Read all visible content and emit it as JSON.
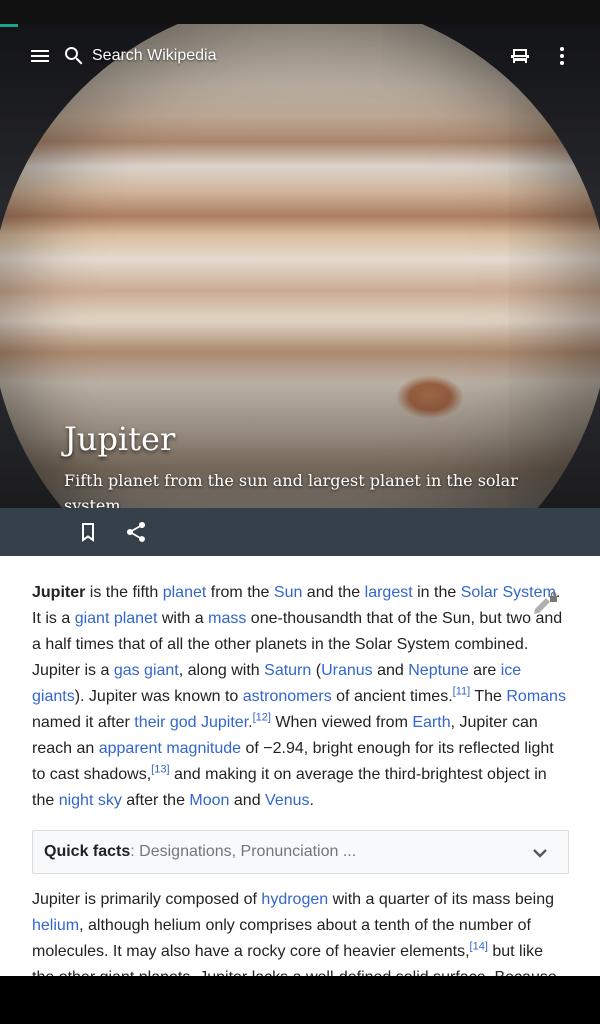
{
  "toolbar": {
    "search_placeholder": "Search Wikipedia",
    "menu_icon": "menu-icon",
    "search_icon": "search-icon",
    "reading_list_icon": "reading-lists-icon",
    "more_icon": "more-vert-icon"
  },
  "hero": {
    "title": "Jupiter",
    "subtitle": "Fifth planet from the sun and largest planet in the solar system"
  },
  "actions": {
    "save_icon": "bookmark-icon",
    "share_icon": "share-icon"
  },
  "lead": {
    "bold": "Jupiter",
    "t1": " is the fifth ",
    "l_planet": "planet",
    "t2": " from the ",
    "l_sun": "Sun",
    "t3": " and the ",
    "l_largest": "largest",
    "t4": " in the ",
    "l_solar_system": "Solar System",
    "t5": ". It is a ",
    "l_giant_planet": "giant planet",
    "t6": " with a ",
    "l_mass": "mass",
    "t7": " one-thousandth that of the Sun, but two and a half times that of all the other planets in the Solar System combined. Jupiter is a ",
    "l_gas_giant": "gas giant",
    "t8": ", along with ",
    "l_saturn": "Saturn",
    "t9": " (",
    "l_uranus": "Uranus",
    "t10": " and ",
    "l_neptune": "Neptune",
    "t11": " are ",
    "l_ice_giants": "ice giants",
    "t12": "). Jupiter was known to ",
    "l_astronomers": "astronomers",
    "t13": " of ancient times.",
    "ref11": "[11]",
    "t14": " The ",
    "l_romans": "Romans",
    "t15": " named it after ",
    "l_their_god": "their god Jupiter",
    "t16": ".",
    "ref12": "[12]",
    "t17": " When viewed from ",
    "l_earth": "Earth",
    "t18": ", Jupiter can reach an ",
    "l_apparent_magnitude": "apparent magnitude",
    "t19": " of −2.94, bright enough for its reflected light to cast shadows,",
    "ref13": "[13]",
    "t20": " and making it on average the third-brightest object in the ",
    "l_night_sky": "night sky",
    "t21": " after the ",
    "l_moon": "Moon",
    "t22": " and ",
    "l_venus": "Venus",
    "t23": "."
  },
  "quick_facts": {
    "title": "Quick facts",
    "summary": ": Designations, Pronunciation ...",
    "chevron_icon": "chevron-down-icon"
  },
  "second": {
    "t1": "Jupiter is primarily composed of ",
    "l_hydrogen": "hydrogen",
    "t2": " with a quarter of its mass being ",
    "l_helium": "helium",
    "t3": ", although helium only comprises about a tenth of the number of molecules. It may also have a rocky core of heavier elements,",
    "ref14": "[14]",
    "t4": " but like the other giant planets, Jupiter lacks a well-defined solid surface. Because of"
  },
  "edit_icon": "edit-lock-icon",
  "colors": {
    "link": "#3366cc",
    "action_bar": "#36404a",
    "progress": "#1aa38a"
  }
}
